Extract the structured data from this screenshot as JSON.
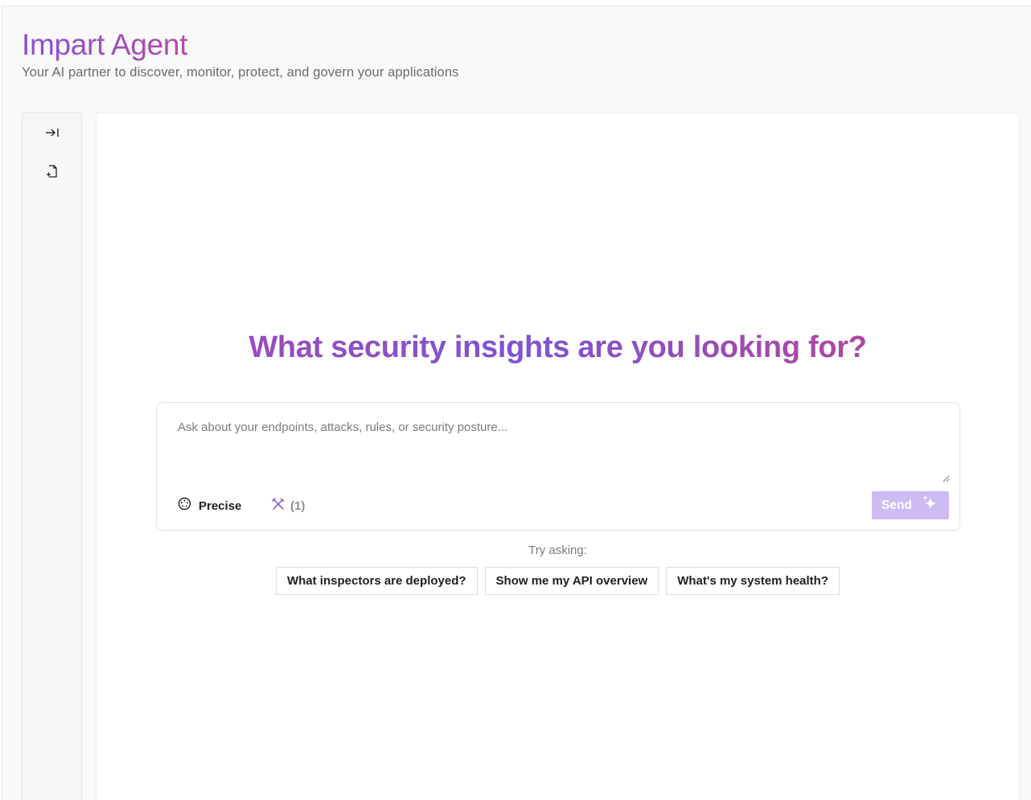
{
  "header": {
    "title": "Impart Agent",
    "subtitle": "Your AI partner to discover, monitor, protect, and govern your applications"
  },
  "sidebar": {
    "items": [
      {
        "icon": "collapse-right-icon"
      },
      {
        "icon": "new-document-icon"
      }
    ]
  },
  "main": {
    "heading": "What security insights are you looking for?",
    "composer": {
      "placeholder": "Ask about your endpoints, attacks, rules, or security posture...",
      "value": "",
      "mode_label": "Precise",
      "tools_count": "(1)",
      "send_label": "Send"
    },
    "try_asking_label": "Try asking:",
    "suggestions": [
      "What inspectors are deployed?",
      "Show me my API overview",
      "What's my system health?"
    ]
  },
  "colors": {
    "brand_purple": "#8a4fd8",
    "brand_magenta": "#b24aa5",
    "send_disabled": "#cdbbf3",
    "tools_icon": "#7a52d6"
  }
}
